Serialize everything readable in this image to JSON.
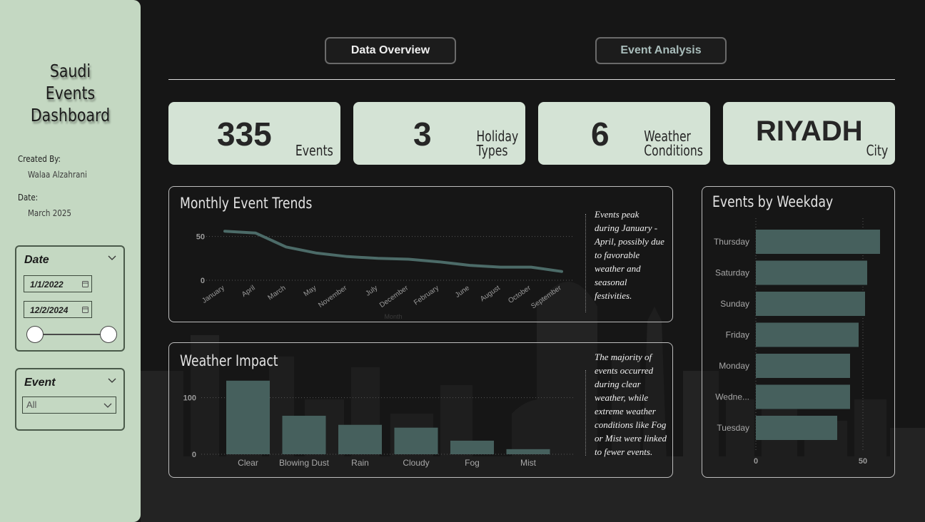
{
  "sidebar": {
    "title_line1": "Saudi",
    "title_line2": "Events",
    "title_line3": "Dashboard",
    "created_by_label": "Created By:",
    "created_by_value": "Walaa Alzahrani",
    "date_label": "Date:",
    "date_value": "March 2025",
    "date_slicer": {
      "title": "Date",
      "start": "1/1/2022",
      "end": "12/2/2024"
    },
    "event_slicer": {
      "title": "Event",
      "selected": "All"
    }
  },
  "tabs": {
    "overview": "Data Overview",
    "analysis": "Event Analysis"
  },
  "kpis": {
    "events": {
      "value": "335",
      "label": "Events"
    },
    "holiday": {
      "value": "3",
      "label_line1": "Holiday",
      "label_line2": "Types"
    },
    "weather": {
      "value": "6",
      "label_line1": "Weather",
      "label_line2": "Conditions"
    },
    "city": {
      "value": "RIYADH",
      "label": "City"
    }
  },
  "monthly": {
    "title": "Monthly Event Trends",
    "note": "Events peak during January - April, possibly due to favorable weather and seasonal festivities."
  },
  "weather_panel": {
    "title": "Weather Impact",
    "note": "The majority of events occurred during clear weather, while extreme weather conditions like Fog or Mist were linked to fewer events."
  },
  "weekday_panel": {
    "title": "Events by Weekday"
  },
  "colors": {
    "sidebar": "#c4d8c2",
    "card": "#d4e3d5",
    "bar": "#46605d",
    "line": "#4c6b68",
    "background": "#161616"
  },
  "chart_data": [
    {
      "type": "line",
      "title": "Monthly Event Trends",
      "xlabel": "Month",
      "categories": [
        "January",
        "April",
        "March",
        "May",
        "November",
        "July",
        "December",
        "February",
        "June",
        "August",
        "October",
        "September"
      ],
      "values": [
        56,
        54,
        38,
        31,
        27,
        25,
        24,
        21,
        17,
        15,
        15,
        10
      ],
      "yticks": [
        0,
        50
      ],
      "ylim": [
        0,
        70
      ]
    },
    {
      "type": "bar",
      "title": "Weather Impact",
      "categories": [
        "Clear",
        "Blowing Dust",
        "Rain",
        "Cloudy",
        "Fog",
        "Mist"
      ],
      "values": [
        130,
        68,
        52,
        47,
        24,
        9
      ],
      "yticks": [
        0,
        100
      ],
      "ylim": [
        0,
        160
      ]
    },
    {
      "type": "bar",
      "orientation": "horizontal",
      "title": "Events by Weekday",
      "categories": [
        "Thursday",
        "Saturday",
        "Sunday",
        "Friday",
        "Monday",
        "Wedne...",
        "Tuesday"
      ],
      "values": [
        58,
        52,
        51,
        48,
        44,
        44,
        38
      ],
      "xticks": [
        0,
        50
      ],
      "xlim": [
        0,
        60
      ]
    }
  ]
}
